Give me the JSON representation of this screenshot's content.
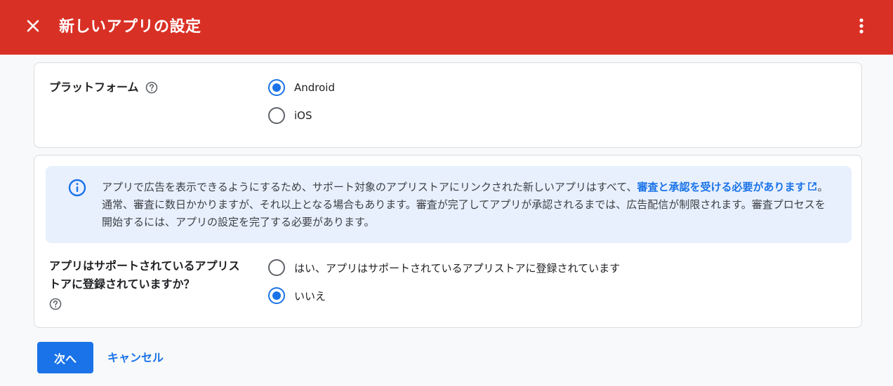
{
  "header": {
    "title": "新しいアプリの設定",
    "close_icon": "close-icon",
    "more_icon": "more-vert-icon",
    "background_color": "#d93025"
  },
  "platform": {
    "label": "プラットフォーム",
    "options": [
      {
        "label": "Android",
        "selected": true
      },
      {
        "label": "iOS",
        "selected": false
      }
    ]
  },
  "info": {
    "text_before": "アプリで広告を表示できるようにするため、サポート対象のアプリストアにリンクされた新しいアプリはすべて、",
    "link_text": "審査と承認を受ける必要があります",
    "text_after": "。通常、審査に数日かかりますが、それ以上となる場合もあります。審査が完了してアプリが承認されるまでは、広告配信が制限されます。審査プロセスを開始するには、アプリの設定を完了する必要があります。"
  },
  "store": {
    "label": "アプリはサポートされているアプリストアに登録されていますか？",
    "options": [
      {
        "label": "はい、アプリはサポートされているアプリストアに登録されています",
        "selected": false
      },
      {
        "label": "いいえ",
        "selected": true
      }
    ]
  },
  "footer": {
    "next_label": "次へ",
    "cancel_label": "キャンセル"
  },
  "colors": {
    "accent": "#1a73e8",
    "info_background": "#e8f0fe"
  }
}
